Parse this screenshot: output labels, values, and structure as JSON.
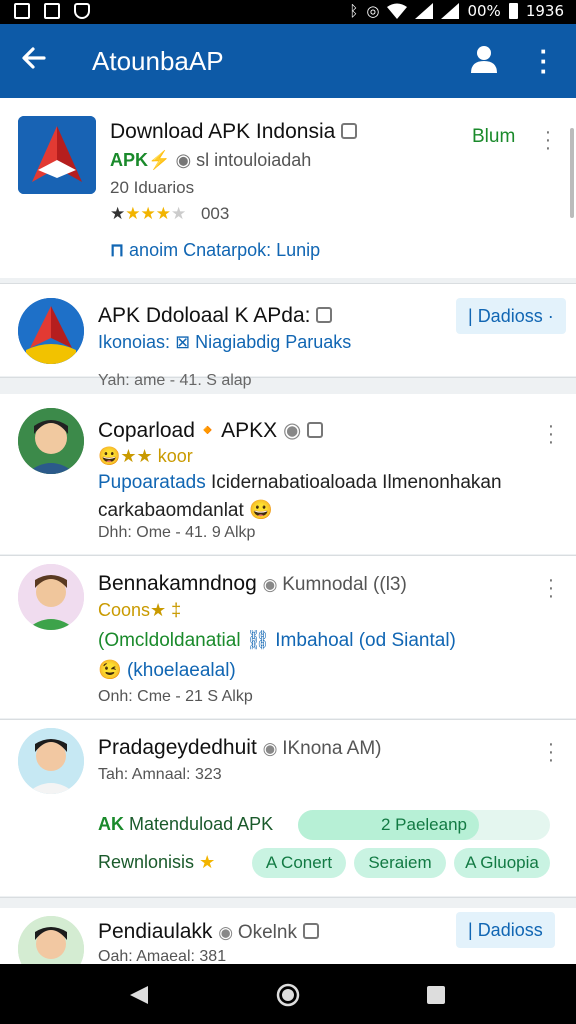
{
  "status_bar": {
    "icons": [
      "image-icon",
      "photo-icon",
      "drive-icon",
      "bluetooth-icon",
      "location-icon",
      "wifi-icon",
      "signal-icon"
    ],
    "battery_text": "00%",
    "time": "1936"
  },
  "app_bar": {
    "title": "AtounbaAP",
    "brand_color": "#0d5aa7"
  },
  "featured": {
    "title": "Download APK Indonsia",
    "action": "Blum",
    "subtitle_app": "APK",
    "subtitle_text": "sl intouloiadah",
    "count": "20 Iduarios",
    "rating_value": "003",
    "rating_stars": 3.5,
    "link": "anoim Cnatarpok: Lunip"
  },
  "post1": {
    "title": "APK Ddoloaal K APda:",
    "follow": "Dadioss",
    "tags": "Ikonoias:",
    "tags2": "Niagiabdig Paruaks",
    "meta": "Yah: ame - 41. S alap"
  },
  "post2": {
    "title": "Coparload",
    "title2": "APKX",
    "badge": "koor",
    "line1_blue": "Pupoaratads",
    "line1_rest": "Icidernabatioaloada Ilmenonhakan",
    "line2": "carkabaomdanlat",
    "meta": "Dhh: Ome - 41. 9 Alkp"
  },
  "post3": {
    "title": "Bennakamndnog",
    "title_after": "Kumnodal ((l3)",
    "badge": "Coons",
    "line1_green": "(Omcldoldanatial",
    "line1_blue": "Imbahoal (od Siantal)",
    "line2": "(khoelaealal)",
    "meta": "Onh: Cme - 21 S Alkp"
  },
  "post4": {
    "title": "Pradageydedhuit",
    "title_after": "IKnona AM)",
    "meta": "Tah: Amnaal: 323",
    "download_label": "Matenduload APK",
    "download_prefix": "AK",
    "progress_label": "2 Paeleanp",
    "progress_fraction": 0.72,
    "footer_label": "Rewnlonisis",
    "chips": [
      "A Conert",
      "Seraiem",
      "A Gluopia"
    ]
  },
  "post5": {
    "title": "Pendiaulakk",
    "title_after": "Okelnk",
    "follow": "Dadioss",
    "meta": "Oah: Amaeal: 381"
  }
}
